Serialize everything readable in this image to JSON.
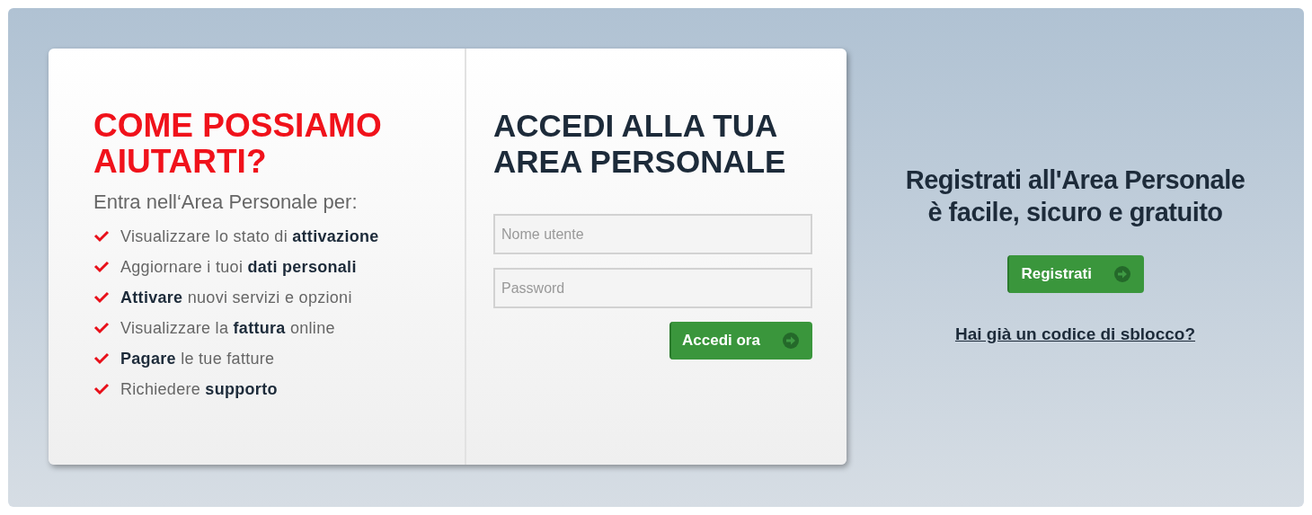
{
  "help_panel": {
    "title": "COME POSSIAMO AIUTARTI?",
    "subtitle": "Entra nell‘Area Personale per:",
    "items": [
      "Visualizzare lo stato di **attivazione**",
      "Aggiornare i tuoi **dati personali**",
      "**Attivare** nuovi servizi e opzioni",
      "Visualizzare la **fattura** online",
      "**Pagare** le tue fatture",
      "Richiedere **supporto**"
    ]
  },
  "login": {
    "title": "ACCEDI ALLA TUA AREA PERSONALE",
    "username": {
      "placeholder": "Nome utente"
    },
    "password": {
      "placeholder": "Password"
    },
    "submit": "Accedi ora"
  },
  "register": {
    "heading_line_1": "Registrati all'Area Personale",
    "heading_line_2": "è facile, sicuro e gratuito",
    "button": "Registrati",
    "unlock_link": "Hai già un codice di sblocco?"
  }
}
